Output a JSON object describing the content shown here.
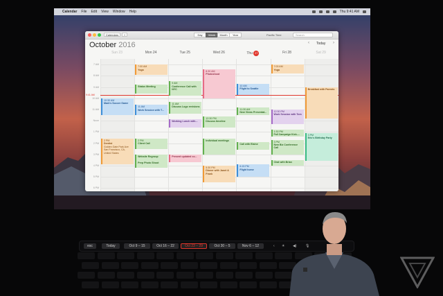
{
  "menubar": {
    "app": "Calendar",
    "items": [
      "File",
      "Edit",
      "View",
      "Window",
      "Help"
    ],
    "clock": "Thu 9:41 AM"
  },
  "toolbar": {
    "calendars_label": "Calendars",
    "add_label": "+",
    "views": [
      "Day",
      "Week",
      "Month",
      "Year"
    ],
    "active_view": "Week",
    "timezone": "Pacific Time",
    "search_placeholder": "Search"
  },
  "calendar": {
    "month": "October",
    "year": "2016",
    "today_button": "Today",
    "prev": "‹",
    "next": "›",
    "days": [
      {
        "label": "Sun 23",
        "faded": true
      },
      {
        "label": "Mon 24",
        "faded": false
      },
      {
        "label": "Tue 25",
        "faded": false
      },
      {
        "label": "Wed 26",
        "faded": false
      },
      {
        "label": "Thu",
        "badge": "27",
        "faded": false
      },
      {
        "label": "Fri 28",
        "faded": false
      },
      {
        "label": "Sat 29",
        "faded": true
      }
    ],
    "hours": [
      "7 AM",
      "8 AM",
      "9 AM",
      "10 AM",
      "11 AM",
      "Noon",
      "1 PM",
      "2 PM",
      "3 PM",
      "4 PM",
      "5 PM",
      "6 PM",
      "7 PM"
    ],
    "now_label": "9:41 AM"
  },
  "events": [
    {
      "day": 1,
      "start": 7.0,
      "end": 7.9,
      "color": "orange",
      "time": "7:00 AM",
      "name": "Yoga"
    },
    {
      "day": 1,
      "start": 8.8,
      "end": 9.6,
      "color": "green",
      "time": "",
      "name": "Status Meeting"
    },
    {
      "day": 0,
      "start": 10.0,
      "end": 11.5,
      "color": "blue",
      "time": "10:30 AM",
      "name": "Mark's Soccer Game"
    },
    {
      "day": 1,
      "start": 10.6,
      "end": 11.5,
      "color": "blue",
      "time": "11 AM",
      "name": "Work Session with T..."
    },
    {
      "day": 0,
      "start": 13.6,
      "end": 15.9,
      "color": "orange",
      "time": "2 PM",
      "name": "Dentist",
      "extra": "Golden Gate Park Ave San Francisco, CA, United States"
    },
    {
      "day": 1,
      "start": 13.6,
      "end": 14.5,
      "color": "green",
      "time": "2 PM",
      "name": "Client Call"
    },
    {
      "day": 1,
      "start": 15.0,
      "end": 15.6,
      "color": "green",
      "time": "",
      "name": "Website Regroup"
    },
    {
      "day": 1,
      "start": 15.6,
      "end": 16.2,
      "color": "green",
      "time": "",
      "name": "Prep Photo Shoot"
    },
    {
      "day": 2,
      "start": 8.5,
      "end": 9.8,
      "color": "green",
      "time": "9 AM",
      "name": "Conference Call with NYC"
    },
    {
      "day": 2,
      "start": 10.3,
      "end": 11.4,
      "color": "green",
      "time": "11 AM",
      "name": "Discuss Logo revisions"
    },
    {
      "day": 2,
      "start": 11.9,
      "end": 12.6,
      "color": "purple",
      "time": "",
      "name": "Working Lunch with..."
    },
    {
      "day": 2,
      "start": 15.0,
      "end": 15.7,
      "color": "pink",
      "time": "",
      "name": "Present updated co..."
    },
    {
      "day": 3,
      "start": 7.4,
      "end": 10.0,
      "color": "pink",
      "time": "8:30 AM",
      "name": "Photoshoot"
    },
    {
      "day": 3,
      "start": 11.6,
      "end": 12.6,
      "color": "green",
      "time": "12:30 PM",
      "name": "Discuss timeline"
    },
    {
      "day": 3,
      "start": 13.6,
      "end": 15.0,
      "color": "green",
      "time": "",
      "name": "Individual meetings"
    },
    {
      "day": 3,
      "start": 16.0,
      "end": 17.5,
      "color": "orange",
      "time": "5:30 PM",
      "name": "Dinner with Janet & Frank"
    },
    {
      "day": 4,
      "start": 8.7,
      "end": 9.7,
      "color": "blue",
      "time": "10 AM",
      "name": "Flight to Seattle"
    },
    {
      "day": 4,
      "start": 10.8,
      "end": 11.5,
      "color": "green",
      "time": "11:30 AM",
      "name": "New Views Presentat..."
    },
    {
      "day": 4,
      "start": 13.9,
      "end": 14.6,
      "color": "green",
      "time": "",
      "name": "Call with Elaine"
    },
    {
      "day": 4,
      "start": 15.9,
      "end": 17.0,
      "color": "blue",
      "time": "6:15 PM",
      "name": "Flight home"
    },
    {
      "day": 5,
      "start": 7.0,
      "end": 7.8,
      "color": "orange",
      "time": "7:00 AM",
      "name": "Yoga"
    },
    {
      "day": 5,
      "start": 11.0,
      "end": 12.3,
      "color": "purple",
      "time": "12:30 PM",
      "name": "Work Session with Tom"
    },
    {
      "day": 5,
      "start": 12.8,
      "end": 13.4,
      "color": "green",
      "time": "1:30 PM",
      "name": "Fall Campaign Kick-..."
    },
    {
      "day": 5,
      "start": 13.7,
      "end": 15.0,
      "color": "green",
      "time": "3 PM",
      "name": "New Biz Conference Call"
    },
    {
      "day": 5,
      "start": 15.5,
      "end": 16.0,
      "color": "green",
      "time": "",
      "name": "Chat with Brian"
    },
    {
      "day": 6,
      "start": 9.0,
      "end": 11.8,
      "color": "orange",
      "time": "",
      "name": "Breakfast with Parents"
    },
    {
      "day": 6,
      "start": 13.1,
      "end": 15.6,
      "color": "teal",
      "time": "3 PM",
      "name": "Eric's Birthday Party"
    }
  ],
  "touchbar": {
    "esc": "esc",
    "today": "Today",
    "weeks": [
      "Oct 9 – 15",
      "Oct 16 – 22",
      "Oct 23 – 29",
      "Oct 30 – 5",
      "Nov 6 – 12"
    ],
    "selected_week": "Oct 23 – 29",
    "controls": [
      "‹",
      "☀",
      "◀)",
      "🎙"
    ]
  }
}
